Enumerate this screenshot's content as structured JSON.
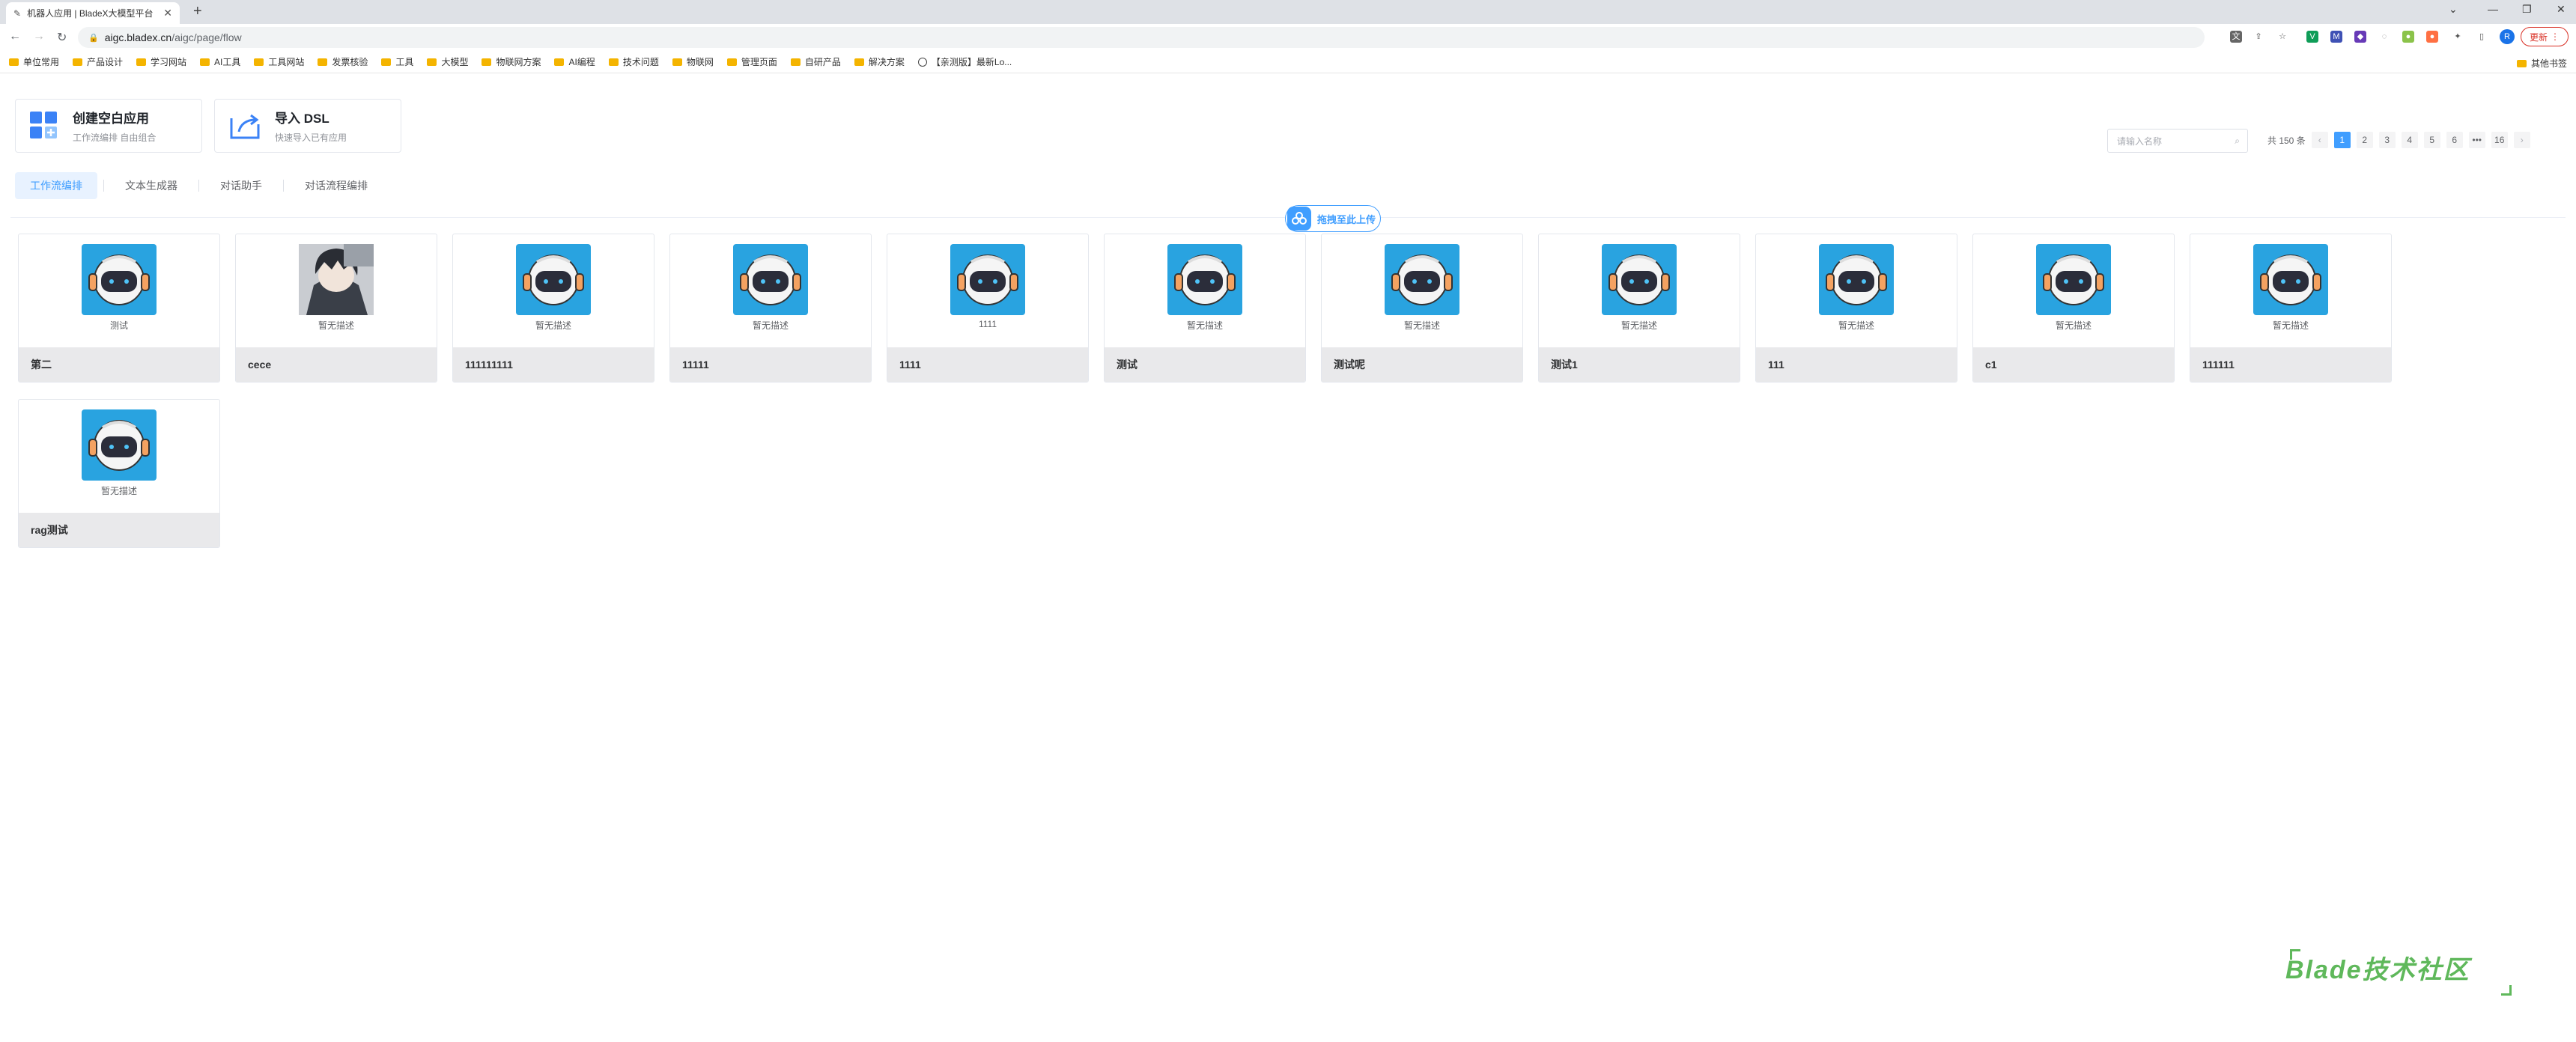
{
  "browser": {
    "tab_title": "机器人应用 | BladeX大模型平台",
    "url_host": "aigc.bladex.cn",
    "url_path": "/aigc/page/flow",
    "update_label": "更新",
    "bookmarks": [
      "单位常用",
      "产品设计",
      "学习网站",
      "AI工具",
      "工具网站",
      "发票核验",
      "工具",
      "大模型",
      "物联网方案",
      "AI编程",
      "技术问题",
      "物联网",
      "管理页面",
      "自研产品",
      "解决方案",
      "【亲测版】最新Lo..."
    ],
    "other_bookmarks": "其他书签"
  },
  "header": {
    "create_title": "创建空白应用",
    "create_sub": "工作流编排 自由组合",
    "import_title": "导入 DSL",
    "import_sub": "快速导入已有应用",
    "search_placeholder": "请输入名称"
  },
  "pagination": {
    "total": "共 150 条",
    "pages": [
      "1",
      "2",
      "3",
      "4",
      "5",
      "6",
      "•••",
      "16"
    ]
  },
  "tabs": [
    "工作流编排",
    "文本生成器",
    "对话助手",
    "对话流程编排"
  ],
  "upload_label": "拖拽至此上传",
  "cards": [
    {
      "name": "第二",
      "desc": "测试",
      "img": "robot"
    },
    {
      "name": "cece",
      "desc": "暂无描述",
      "img": "person"
    },
    {
      "name": "111111111",
      "desc": "暂无描述",
      "img": "robot"
    },
    {
      "name": "11111",
      "desc": "暂无描述",
      "img": "robot"
    },
    {
      "name": "1111",
      "desc": "1111",
      "img": "robot"
    },
    {
      "name": "测试",
      "desc": "暂无描述",
      "img": "robot"
    },
    {
      "name": "测试呢",
      "desc": "暂无描述",
      "img": "robot"
    },
    {
      "name": "测试1",
      "desc": "暂无描述",
      "img": "robot"
    },
    {
      "name": "111",
      "desc": "暂无描述",
      "img": "robot"
    },
    {
      "name": "c1",
      "desc": "暂无描述",
      "img": "robot"
    },
    {
      "name": "111111",
      "desc": "暂无描述",
      "img": "robot"
    },
    {
      "name": "rag测试",
      "desc": "暂无描述",
      "img": "robot"
    }
  ],
  "watermark": "Blade技术社区",
  "colors": {
    "accent": "#409eff",
    "robot_bg": "#29a3e0",
    "watermark": "#5fb85b"
  }
}
